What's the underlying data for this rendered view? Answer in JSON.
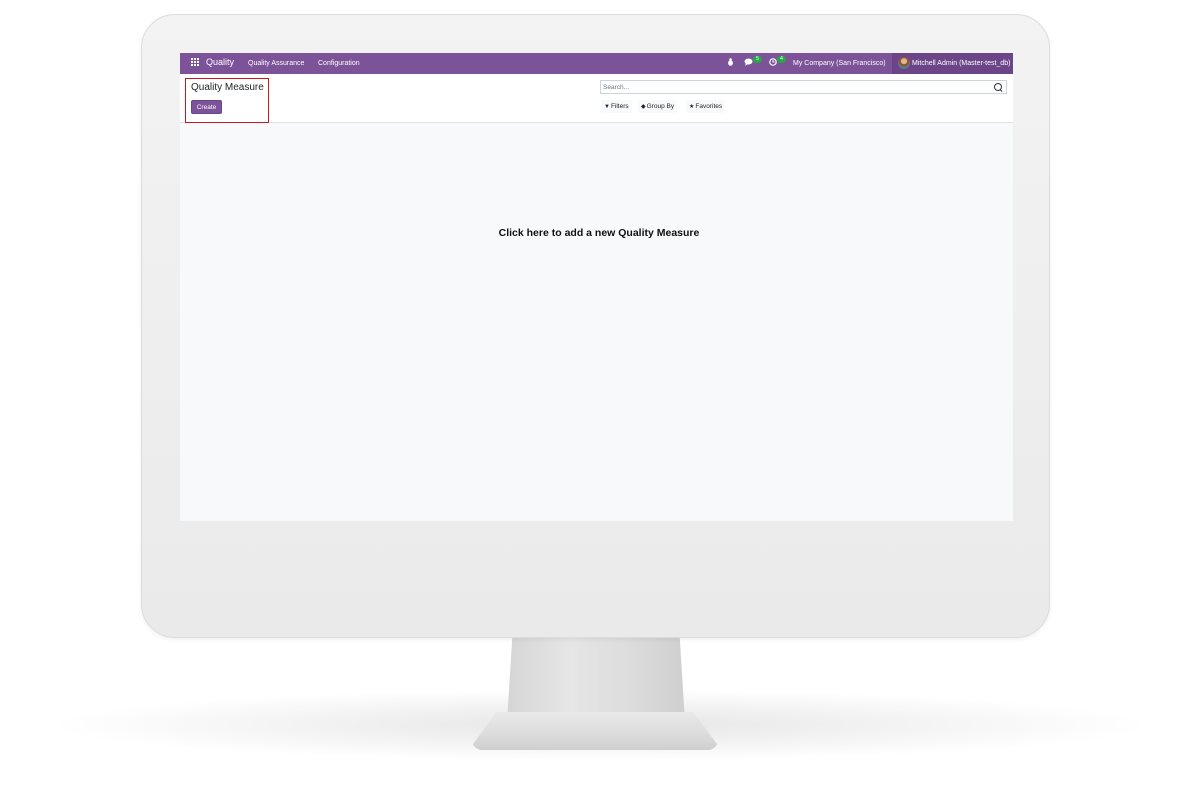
{
  "navbar": {
    "app_name": "Quality",
    "menu": [
      "Quality Assurance",
      "Configuration"
    ],
    "messages_count": "5",
    "activities_count": "4",
    "company": "My Company (San Francisco)",
    "user": "Mitchell Admin (Master-test_db)"
  },
  "control_panel": {
    "breadcrumb": "Quality Measure",
    "create_label": "Create",
    "search_placeholder": "Search...",
    "filters_label": "Filters",
    "group_by_label": "Group By",
    "favorites_label": "Favorites"
  },
  "main": {
    "empty_message": "Click here to add a new Quality Measure"
  },
  "colors": {
    "brand": "#7c5299",
    "highlight": "#d0141e",
    "badge": "#28a745"
  },
  "icons": [
    "apps-grid-icon",
    "bug-icon",
    "chat-icon",
    "clock-icon",
    "filter-icon",
    "layers-icon",
    "star-icon",
    "search-icon"
  ]
}
